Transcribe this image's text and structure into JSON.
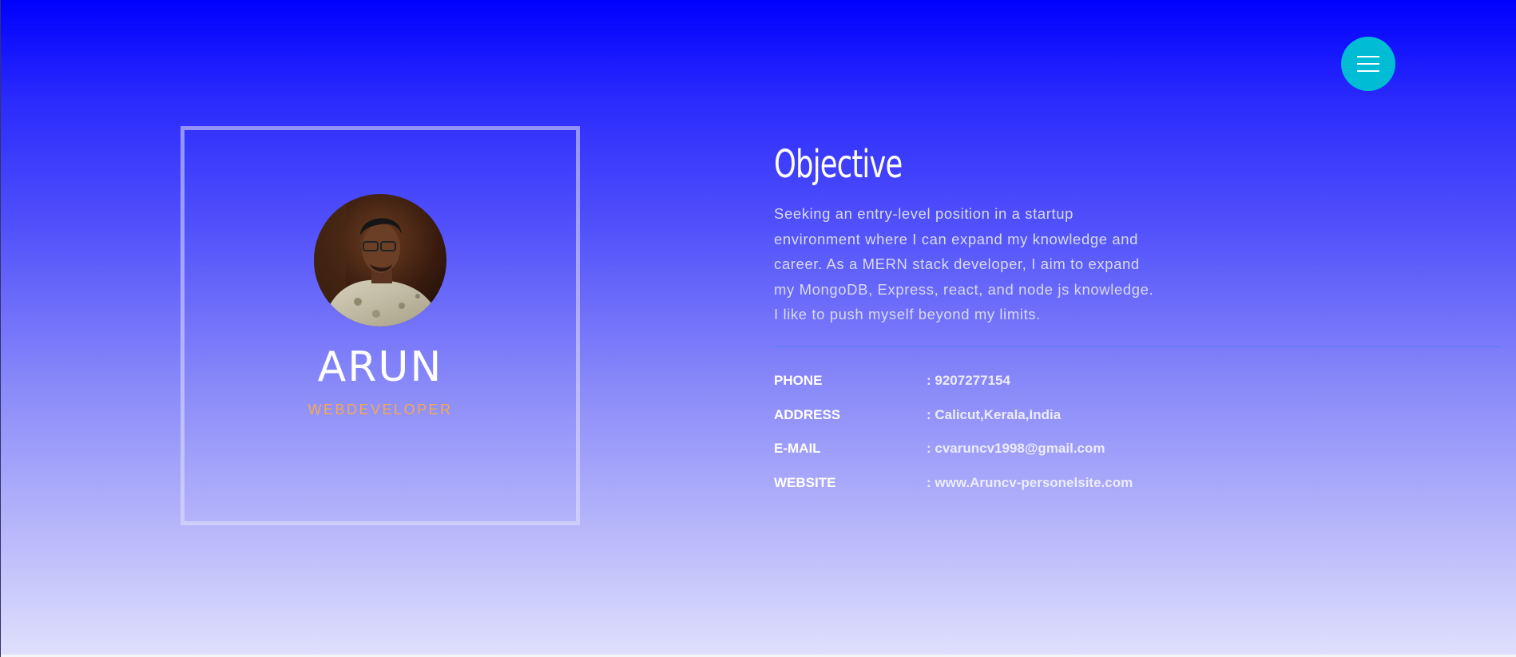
{
  "menu": {
    "icon": "hamburger-menu-icon"
  },
  "profile": {
    "name": "ARUN",
    "role": "WEBDEVELOPER",
    "avatar": "profile-photo"
  },
  "objective": {
    "title": "Objective",
    "text": "Seeking an entry-level position in a startup environment where I can expand my knowledge and career. As a MERN stack developer, I aim to expand my MongoDB, Express, react, and node js knowledge. I like to push myself beyond my limits."
  },
  "contact": [
    {
      "label": "PHONE",
      "value": ": 9207277154"
    },
    {
      "label": "ADDRESS",
      "value": ": Calicut,Kerala,India"
    },
    {
      "label": "E-MAIL",
      "value": ":  cvaruncv1998@gmail.com"
    },
    {
      "label": "WEBSITE",
      "value": ": www.Aruncv-personelsite.com"
    }
  ],
  "colors": {
    "gradient_top": "#0000ff",
    "gradient_bottom": "#e0e0fc",
    "accent_menu": "#00bcd4",
    "role_color": "#f6a94d"
  }
}
